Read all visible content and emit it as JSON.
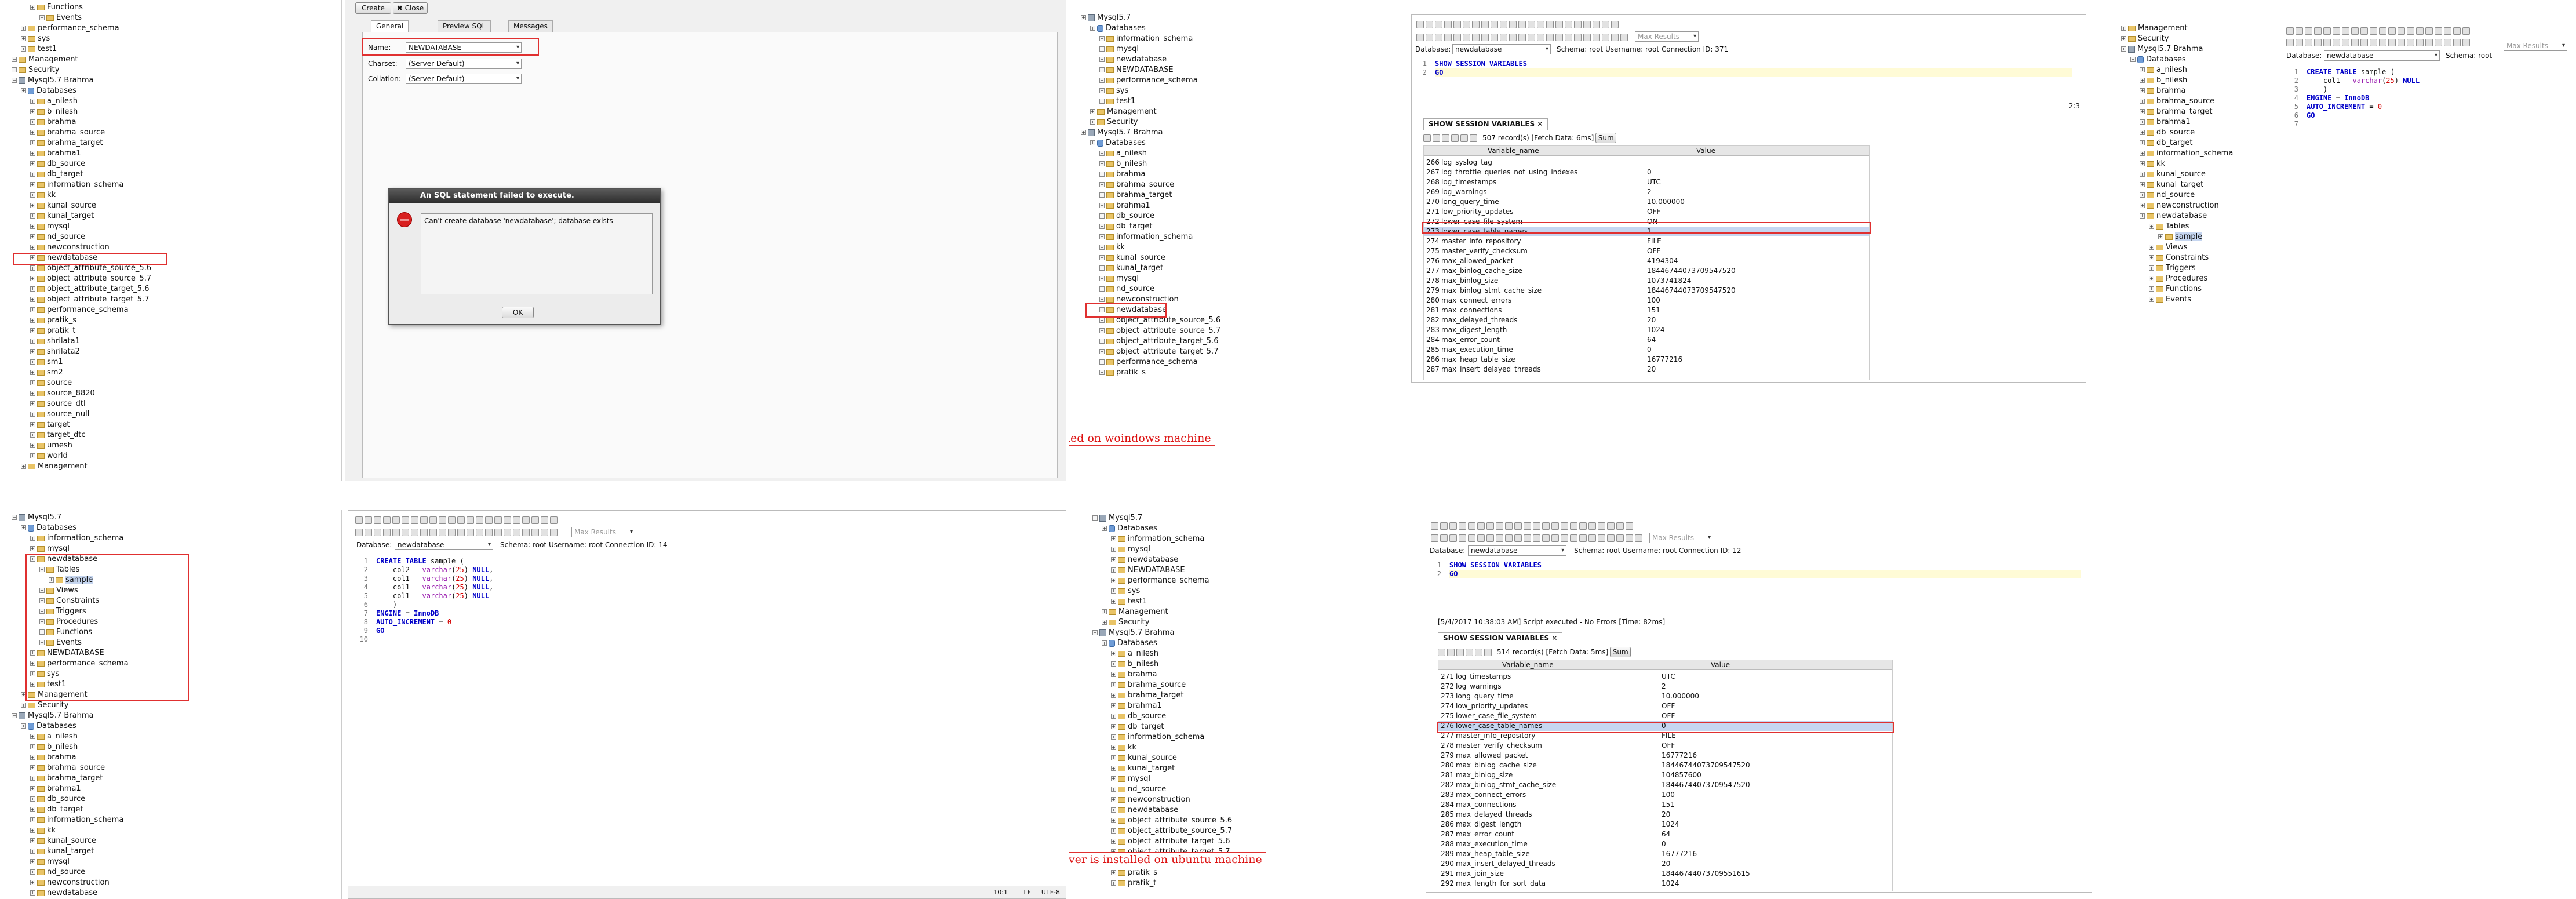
{
  "colors": {
    "highlight_box": "#e03030",
    "selected_row": "#c6d6f0",
    "keyword": "#0000c8",
    "varchar": "#9b1fb0",
    "number": "#d40000"
  },
  "p1": {
    "tree": [
      "Functions",
      "Events",
      "performance_schema",
      "sys",
      "test1",
      "Management",
      "Security",
      "Mysql5.7 Brahma",
      "Databases",
      "a_nilesh",
      "b_nilesh",
      "brahma",
      "brahma_source",
      "brahma_target",
      "brahma1",
      "db_source",
      "db_target",
      "information_schema",
      "kk",
      "kunal_source",
      "kunal_target",
      "mysql",
      "nd_source",
      "newconstruction",
      "newdatabase",
      "object_attribute_source_5.6",
      "object_attribute_source_5.7",
      "object_attribute_target_5.6",
      "object_attribute_target_5.7",
      "performance_schema",
      "pratik_s",
      "pratik_t",
      "shrilata1",
      "shrilata2",
      "sm1",
      "sm2",
      "source",
      "source_8820",
      "source_dtl",
      "source_null",
      "target",
      "target_dtc",
      "umesh",
      "world",
      "Management"
    ]
  },
  "p2": {
    "create_btn": "Create",
    "close_btn": "Close",
    "tabs": [
      "General",
      "Preview SQL",
      "Messages"
    ],
    "name_label": "Name:",
    "name_value": "NEWDATABASE",
    "charset_label": "Charset:",
    "charset_value": "(Server Default)",
    "collation_label": "Collation:",
    "collation_value": "(Server Default)",
    "dialog_title": "An SQL statement failed to execute.",
    "dialog_msg": "Can't create database 'newdatabase'; database exists",
    "ok": "OK"
  },
  "p3": {
    "tree": [
      "Mysql5.7",
      "Databases",
      "information_schema",
      "mysql",
      "newdatabase",
      "NEWDATABASE",
      "performance_schema",
      "sys",
      "test1",
      "Management",
      "Security",
      "Mysql5.7 Brahma",
      "Databases",
      "a_nilesh",
      "b_nilesh",
      "brahma",
      "brahma_source",
      "brahma_target",
      "brahma1",
      "db_source",
      "db_target",
      "information_schema",
      "kk",
      "kunal_source",
      "kunal_target",
      "mysql",
      "nd_source",
      "newconstruction",
      "newdatabase",
      "object_attribute_source_5.6",
      "object_attribute_source_5.7",
      "object_attribute_target_5.6",
      "object_attribute_target_5.7",
      "performance_schema",
      "pratik_s"
    ],
    "note": "This server is installed on woindows machine"
  },
  "p4": {
    "db_label": "Database:",
    "db_value": "newdatabase",
    "conn": "Schema: root    Username: root    Connection ID: 371",
    "max_results": "Max Results",
    "code": [
      "SHOW SESSION VARIABLES",
      "GO"
    ],
    "pos": "2:3",
    "result_tab": "SHOW SESSION VARIABLES",
    "records": "507 record(s) [Fetch Data: 6ms]",
    "sum": "Sum",
    "col1": "Variable_name",
    "col2": "Value",
    "rows": [
      [
        "266",
        "log_syslog_tag",
        ""
      ],
      [
        "267",
        "log_throttle_queries_not_using_indexes",
        "0"
      ],
      [
        "268",
        "log_timestamps",
        "UTC"
      ],
      [
        "269",
        "log_warnings",
        "2"
      ],
      [
        "270",
        "long_query_time",
        "10.000000"
      ],
      [
        "271",
        "low_priority_updates",
        "OFF"
      ],
      [
        "272",
        "lower_case_file_system",
        "ON"
      ],
      [
        "273",
        "lower_case_table_names",
        "1"
      ],
      [
        "274",
        "master_info_repository",
        "FILE"
      ],
      [
        "275",
        "master_verify_checksum",
        "OFF"
      ],
      [
        "276",
        "max_allowed_packet",
        "4194304"
      ],
      [
        "277",
        "max_binlog_cache_size",
        "18446744073709547520"
      ],
      [
        "278",
        "max_binlog_size",
        "1073741824"
      ],
      [
        "279",
        "max_binlog_stmt_cache_size",
        "18446744073709547520"
      ],
      [
        "280",
        "max_connect_errors",
        "100"
      ],
      [
        "281",
        "max_connections",
        "151"
      ],
      [
        "282",
        "max_delayed_threads",
        "20"
      ],
      [
        "283",
        "max_digest_length",
        "1024"
      ],
      [
        "284",
        "max_error_count",
        "64"
      ],
      [
        "285",
        "max_execution_time",
        "0"
      ],
      [
        "286",
        "max_heap_table_size",
        "16777216"
      ],
      [
        "287",
        "max_insert_delayed_threads",
        "20"
      ]
    ]
  },
  "p5": {
    "tree": [
      "Management",
      "Security",
      "Mysql5.7 Brahma",
      "Databases",
      "a_nilesh",
      "b_nilesh",
      "brahma",
      "brahma_source",
      "brahma_target",
      "brahma1",
      "db_source",
      "db_target",
      "information_schema",
      "kk",
      "kunal_source",
      "kunal_target",
      "nd_source",
      "newconstruction",
      "newdatabase",
      "Tables",
      "sample",
      "Views",
      "Constraints",
      "Triggers",
      "Procedures",
      "Functions",
      "Events"
    ],
    "db_label": "Database:",
    "db_value": "newdatabase",
    "conn": "Schema: root",
    "max_results": "Max Results",
    "code": [
      "CREATE TABLE sample (",
      "    col1   varchar(25) NULL",
      "    )",
      "ENGINE = InnoDB",
      "AUTO_INCREMENT = 0",
      "GO",
      ""
    ]
  },
  "p6": {
    "tree": [
      "Mysql5.7",
      "Databases",
      "information_schema",
      "mysql",
      "newdatabase",
      "Tables",
      "sample",
      "Views",
      "Constraints",
      "Triggers",
      "Procedures",
      "Functions",
      "Events",
      "NEWDATABASE",
      "performance_schema",
      "sys",
      "test1",
      "Management",
      "Security",
      "Mysql5.7 Brahma",
      "Databases",
      "a_nilesh",
      "b_nilesh",
      "brahma",
      "brahma_source",
      "brahma_target",
      "brahma1",
      "db_source",
      "db_target",
      "information_schema",
      "kk",
      "kunal_source",
      "kunal_target",
      "mysql",
      "nd_source",
      "newconstruction",
      "newdatabase"
    ]
  },
  "p7": {
    "db_label": "Database:",
    "db_value": "newdatabase",
    "conn": "Schema: root    Username: root    Connection ID: 14",
    "max_results": "Max Results",
    "code": [
      "CREATE TABLE sample (",
      "    col2   varchar(25) NULL,",
      "    col1   varchar(25) NULL,",
      "    col1   varchar(25) NULL,",
      "    col1   varchar(25) NULL",
      "    )",
      "ENGINE = InnoDB",
      "AUTO_INCREMENT = 0",
      "GO",
      ""
    ],
    "status_pos": "10:1",
    "status_lf": "LF",
    "status_enc": "UTF-8"
  },
  "p8": {
    "tree": [
      "Mysql5.7",
      "Databases",
      "information_schema",
      "mysql",
      "newdatabase",
      "NEWDATABASE",
      "performance_schema",
      "sys",
      "test1",
      "Management",
      "Security",
      "Mysql5.7 Brahma",
      "Databases",
      "a_nilesh",
      "b_nilesh",
      "brahma",
      "brahma_source",
      "brahma_target",
      "brahma1",
      "db_source",
      "db_target",
      "information_schema",
      "kk",
      "kunal_source",
      "kunal_target",
      "mysql",
      "nd_source",
      "newconstruction",
      "newdatabase",
      "object_attribute_source_5.6",
      "object_attribute_source_5.7",
      "object_attribute_target_5.6",
      "object_attribute_target_5.7",
      "performance_schema",
      "pratik_s",
      "pratik_t"
    ],
    "note": "This server is installed on ubuntu machine"
  },
  "p9": {
    "db_label": "Database:",
    "db_value": "newdatabase",
    "conn": "Schema: root    Username: root    Connection ID: 12",
    "max_results": "Max Results",
    "code": [
      "SHOW SESSION VARIABLES",
      "GO"
    ],
    "message": "[5/4/2017 10:38:03 AM] Script executed - No Errors [Time: 82ms]",
    "result_tab": "SHOW SESSION VARIABLES",
    "records": "514 record(s) [Fetch Data: 5ms]",
    "sum": "Sum",
    "col1": "Variable_name",
    "col2": "Value",
    "rows": [
      [
        "271",
        "log_timestamps",
        "UTC"
      ],
      [
        "272",
        "log_warnings",
        "2"
      ],
      [
        "273",
        "long_query_time",
        "10.000000"
      ],
      [
        "274",
        "low_priority_updates",
        "OFF"
      ],
      [
        "275",
        "lower_case_file_system",
        "OFF"
      ],
      [
        "276",
        "lower_case_table_names",
        "0"
      ],
      [
        "277",
        "master_info_repository",
        "FILE"
      ],
      [
        "278",
        "master_verify_checksum",
        "OFF"
      ],
      [
        "279",
        "max_allowed_packet",
        "16777216"
      ],
      [
        "280",
        "max_binlog_cache_size",
        "18446744073709547520"
      ],
      [
        "281",
        "max_binlog_size",
        "104857600"
      ],
      [
        "282",
        "max_binlog_stmt_cache_size",
        "18446744073709547520"
      ],
      [
        "283",
        "max_connect_errors",
        "100"
      ],
      [
        "284",
        "max_connections",
        "151"
      ],
      [
        "285",
        "max_delayed_threads",
        "20"
      ],
      [
        "286",
        "max_digest_length",
        "1024"
      ],
      [
        "287",
        "max_error_count",
        "64"
      ],
      [
        "288",
        "max_execution_time",
        "0"
      ],
      [
        "289",
        "max_heap_table_size",
        "16777216"
      ],
      [
        "290",
        "max_insert_delayed_threads",
        "20"
      ],
      [
        "291",
        "max_join_size",
        "18446744073709551615"
      ],
      [
        "292",
        "max_length_for_sort_data",
        "1024"
      ]
    ]
  }
}
